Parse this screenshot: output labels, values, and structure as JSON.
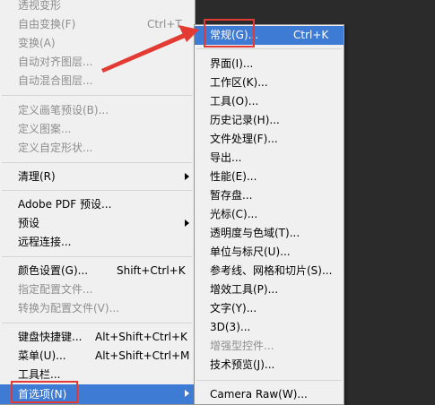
{
  "main_menu": {
    "items": [
      {
        "label": "透视变形",
        "shortcut": "",
        "disabled": true
      },
      {
        "label": "自由变换(F)",
        "shortcut": "Ctrl+T",
        "disabled": true
      },
      {
        "label": "变换(A)",
        "shortcut": "",
        "disabled": true
      },
      {
        "label": "自动对齐图层...",
        "shortcut": "",
        "disabled": true
      },
      {
        "label": "自动混合图层...",
        "shortcut": "",
        "disabled": true
      },
      {
        "label": "定义画笔预设(B)...",
        "shortcut": "",
        "disabled": true
      },
      {
        "label": "定义图案...",
        "shortcut": "",
        "disabled": true
      },
      {
        "label": "定义自定形状...",
        "shortcut": "",
        "disabled": true
      },
      {
        "label": "清理(R)",
        "shortcut": "",
        "disabled": false
      },
      {
        "label": "Adobe PDF 预设...",
        "shortcut": "",
        "disabled": false
      },
      {
        "label": "预设",
        "shortcut": "",
        "disabled": false
      },
      {
        "label": "远程连接...",
        "shortcut": "",
        "disabled": false
      },
      {
        "label": "颜色设置(G)...",
        "shortcut": "Shift+Ctrl+K",
        "disabled": false
      },
      {
        "label": "指定配置文件...",
        "shortcut": "",
        "disabled": true
      },
      {
        "label": "转换为配置文件(V)...",
        "shortcut": "",
        "disabled": true
      },
      {
        "label": "键盘快捷键...",
        "shortcut": "Alt+Shift+Ctrl+K",
        "disabled": false
      },
      {
        "label": "菜单(U)...",
        "shortcut": "Alt+Shift+Ctrl+M",
        "disabled": false
      },
      {
        "label": "工具栏...",
        "shortcut": "",
        "disabled": false
      },
      {
        "label": "首选项(N)",
        "shortcut": "",
        "disabled": false
      }
    ]
  },
  "sub_menu": {
    "items": [
      {
        "label": "常规(G)...",
        "shortcut": "Ctrl+K",
        "disabled": false
      },
      {
        "label": "界面(I)...",
        "shortcut": "",
        "disabled": false
      },
      {
        "label": "工作区(K)...",
        "shortcut": "",
        "disabled": false
      },
      {
        "label": "工具(O)...",
        "shortcut": "",
        "disabled": false
      },
      {
        "label": "历史记录(H)...",
        "shortcut": "",
        "disabled": false
      },
      {
        "label": "文件处理(F)...",
        "shortcut": "",
        "disabled": false
      },
      {
        "label": "导出...",
        "shortcut": "",
        "disabled": false
      },
      {
        "label": "性能(E)...",
        "shortcut": "",
        "disabled": false
      },
      {
        "label": "暂存盘...",
        "shortcut": "",
        "disabled": false
      },
      {
        "label": "光标(C)...",
        "shortcut": "",
        "disabled": false
      },
      {
        "label": "透明度与色域(T)...",
        "shortcut": "",
        "disabled": false
      },
      {
        "label": "单位与标尺(U)...",
        "shortcut": "",
        "disabled": false
      },
      {
        "label": "参考线、网格和切片(S)...",
        "shortcut": "",
        "disabled": false
      },
      {
        "label": "增效工具(P)...",
        "shortcut": "",
        "disabled": false
      },
      {
        "label": "文字(Y)...",
        "shortcut": "",
        "disabled": false
      },
      {
        "label": "3D(3)...",
        "shortcut": "",
        "disabled": false
      },
      {
        "label": "增强型控件...",
        "shortcut": "",
        "disabled": true
      },
      {
        "label": "技术预览(J)...",
        "shortcut": "",
        "disabled": false
      },
      {
        "label": "Camera Raw(W)...",
        "shortcut": "",
        "disabled": false
      }
    ]
  },
  "colors": {
    "highlight": "#3d7bd5",
    "annotation": "#e33a33",
    "menu_bg": "#f0f0f0",
    "disabled_text": "#8e8e8e"
  }
}
